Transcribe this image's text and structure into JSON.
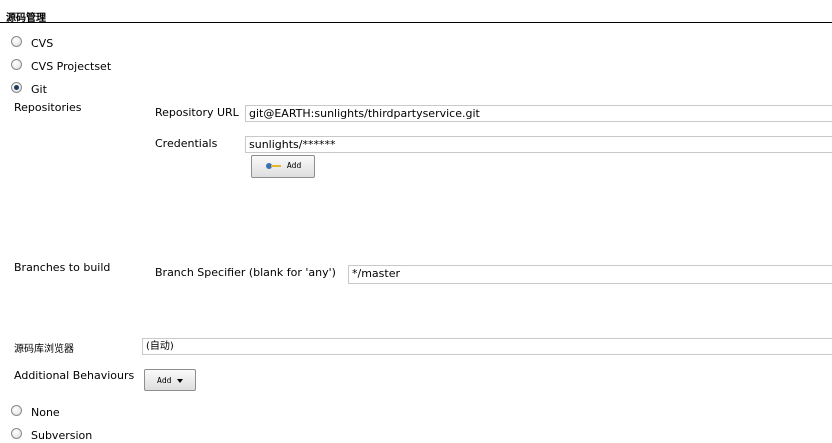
{
  "section": {
    "title": "源码管理"
  },
  "scm_options": [
    {
      "label": "CVS",
      "checked": false
    },
    {
      "label": "CVS Projectset",
      "checked": false
    },
    {
      "label": "Git",
      "checked": true
    }
  ],
  "git": {
    "repositories_label": "Repositories",
    "repository_url_label": "Repository URL",
    "repository_url_value": "git@EARTH:sunlights/thirdpartyservice.git",
    "credentials_label": "Credentials",
    "credentials_value": "sunlights/******",
    "add_credentials_label": "Add",
    "branches_label": "Branches to build",
    "branch_specifier_label": "Branch Specifier (blank for 'any')",
    "branch_specifier_value": "*/master",
    "repo_browser_label": "源码库浏览器",
    "repo_browser_value": "(自动)",
    "additional_behaviours_label": "Additional Behaviours",
    "add_behaviour_label": "Add"
  },
  "scm_options_after": [
    {
      "label": "None",
      "checked": false
    },
    {
      "label": "Subversion",
      "checked": false
    }
  ],
  "icons": {
    "credentials_add": "key-icon",
    "behaviour_add": "chevron-down-icon"
  }
}
